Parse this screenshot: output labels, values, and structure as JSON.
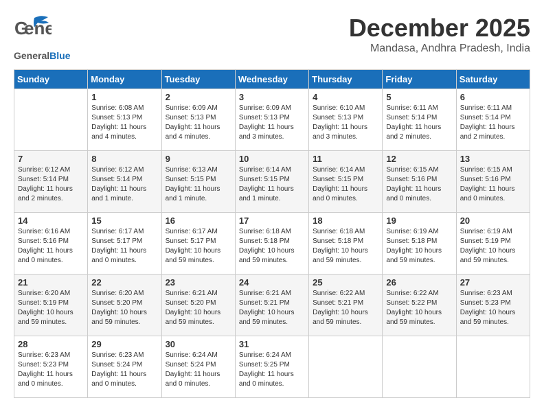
{
  "header": {
    "logo_general": "General",
    "logo_blue": "Blue",
    "month_title": "December 2025",
    "location": "Mandasa, Andhra Pradesh, India"
  },
  "days_of_week": [
    "Sunday",
    "Monday",
    "Tuesday",
    "Wednesday",
    "Thursday",
    "Friday",
    "Saturday"
  ],
  "weeks": [
    [
      {
        "day": "",
        "info": ""
      },
      {
        "day": "1",
        "info": "Sunrise: 6:08 AM\nSunset: 5:13 PM\nDaylight: 11 hours\nand 4 minutes."
      },
      {
        "day": "2",
        "info": "Sunrise: 6:09 AM\nSunset: 5:13 PM\nDaylight: 11 hours\nand 4 minutes."
      },
      {
        "day": "3",
        "info": "Sunrise: 6:09 AM\nSunset: 5:13 PM\nDaylight: 11 hours\nand 3 minutes."
      },
      {
        "day": "4",
        "info": "Sunrise: 6:10 AM\nSunset: 5:13 PM\nDaylight: 11 hours\nand 3 minutes."
      },
      {
        "day": "5",
        "info": "Sunrise: 6:11 AM\nSunset: 5:14 PM\nDaylight: 11 hours\nand 2 minutes."
      },
      {
        "day": "6",
        "info": "Sunrise: 6:11 AM\nSunset: 5:14 PM\nDaylight: 11 hours\nand 2 minutes."
      }
    ],
    [
      {
        "day": "7",
        "info": "Sunrise: 6:12 AM\nSunset: 5:14 PM\nDaylight: 11 hours\nand 2 minutes."
      },
      {
        "day": "8",
        "info": "Sunrise: 6:12 AM\nSunset: 5:14 PM\nDaylight: 11 hours\nand 1 minute."
      },
      {
        "day": "9",
        "info": "Sunrise: 6:13 AM\nSunset: 5:15 PM\nDaylight: 11 hours\nand 1 minute."
      },
      {
        "day": "10",
        "info": "Sunrise: 6:14 AM\nSunset: 5:15 PM\nDaylight: 11 hours\nand 1 minute."
      },
      {
        "day": "11",
        "info": "Sunrise: 6:14 AM\nSunset: 5:15 PM\nDaylight: 11 hours\nand 0 minutes."
      },
      {
        "day": "12",
        "info": "Sunrise: 6:15 AM\nSunset: 5:16 PM\nDaylight: 11 hours\nand 0 minutes."
      },
      {
        "day": "13",
        "info": "Sunrise: 6:15 AM\nSunset: 5:16 PM\nDaylight: 11 hours\nand 0 minutes."
      }
    ],
    [
      {
        "day": "14",
        "info": "Sunrise: 6:16 AM\nSunset: 5:16 PM\nDaylight: 11 hours\nand 0 minutes."
      },
      {
        "day": "15",
        "info": "Sunrise: 6:17 AM\nSunset: 5:17 PM\nDaylight: 11 hours\nand 0 minutes."
      },
      {
        "day": "16",
        "info": "Sunrise: 6:17 AM\nSunset: 5:17 PM\nDaylight: 10 hours\nand 59 minutes."
      },
      {
        "day": "17",
        "info": "Sunrise: 6:18 AM\nSunset: 5:18 PM\nDaylight: 10 hours\nand 59 minutes."
      },
      {
        "day": "18",
        "info": "Sunrise: 6:18 AM\nSunset: 5:18 PM\nDaylight: 10 hours\nand 59 minutes."
      },
      {
        "day": "19",
        "info": "Sunrise: 6:19 AM\nSunset: 5:18 PM\nDaylight: 10 hours\nand 59 minutes."
      },
      {
        "day": "20",
        "info": "Sunrise: 6:19 AM\nSunset: 5:19 PM\nDaylight: 10 hours\nand 59 minutes."
      }
    ],
    [
      {
        "day": "21",
        "info": "Sunrise: 6:20 AM\nSunset: 5:19 PM\nDaylight: 10 hours\nand 59 minutes."
      },
      {
        "day": "22",
        "info": "Sunrise: 6:20 AM\nSunset: 5:20 PM\nDaylight: 10 hours\nand 59 minutes."
      },
      {
        "day": "23",
        "info": "Sunrise: 6:21 AM\nSunset: 5:20 PM\nDaylight: 10 hours\nand 59 minutes."
      },
      {
        "day": "24",
        "info": "Sunrise: 6:21 AM\nSunset: 5:21 PM\nDaylight: 10 hours\nand 59 minutes."
      },
      {
        "day": "25",
        "info": "Sunrise: 6:22 AM\nSunset: 5:21 PM\nDaylight: 10 hours\nand 59 minutes."
      },
      {
        "day": "26",
        "info": "Sunrise: 6:22 AM\nSunset: 5:22 PM\nDaylight: 10 hours\nand 59 minutes."
      },
      {
        "day": "27",
        "info": "Sunrise: 6:23 AM\nSunset: 5:23 PM\nDaylight: 10 hours\nand 59 minutes."
      }
    ],
    [
      {
        "day": "28",
        "info": "Sunrise: 6:23 AM\nSunset: 5:23 PM\nDaylight: 11 hours\nand 0 minutes."
      },
      {
        "day": "29",
        "info": "Sunrise: 6:23 AM\nSunset: 5:24 PM\nDaylight: 11 hours\nand 0 minutes."
      },
      {
        "day": "30",
        "info": "Sunrise: 6:24 AM\nSunset: 5:24 PM\nDaylight: 11 hours\nand 0 minutes."
      },
      {
        "day": "31",
        "info": "Sunrise: 6:24 AM\nSunset: 5:25 PM\nDaylight: 11 hours\nand 0 minutes."
      },
      {
        "day": "",
        "info": ""
      },
      {
        "day": "",
        "info": ""
      },
      {
        "day": "",
        "info": ""
      }
    ]
  ]
}
